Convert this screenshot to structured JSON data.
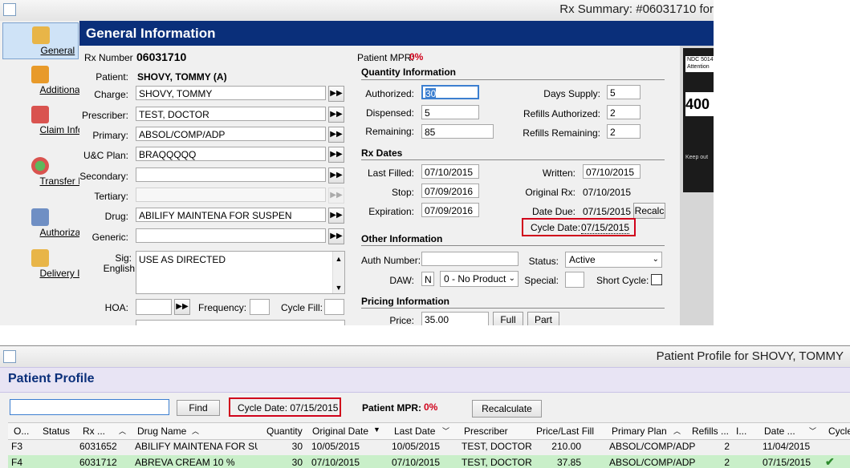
{
  "rx_window": {
    "title": "Rx Summary: #06031710 for",
    "header": "General Information",
    "nav": [
      {
        "label": "General",
        "icon": "document-icon"
      },
      {
        "label": "Additional",
        "icon": "pill-bottle-icon"
      },
      {
        "label": "Claim Information",
        "icon": "claim-icon"
      },
      {
        "label": "Transfer Information",
        "icon": "transfer-icon"
      },
      {
        "label": "Authorization",
        "icon": "pen-icon"
      },
      {
        "label": "Delivery Information",
        "icon": "delivery-icon"
      }
    ],
    "rx_number_label": "Rx Number",
    "rx_number": "06031710",
    "patient_mpr_label": "Patient MPR:",
    "patient_mpr": "0%",
    "patient_label": "Patient:",
    "patient": "SHOVY, TOMMY (A)",
    "charge_label": "Charge:",
    "charge": "SHOVY, TOMMY",
    "prescriber_label": "Prescriber:",
    "prescriber": "TEST, DOCTOR",
    "primary_label": "Primary:",
    "primary": "ABSOL/COMP/ADP",
    "uc_plan_label": "U&C Plan:",
    "uc_plan": "BRAQQQQQ",
    "secondary_label": "Secondary:",
    "secondary": "",
    "tertiary_label": "Tertiary:",
    "tertiary": "",
    "drug_label": "Drug:",
    "drug": "ABILIFY MAINTENA FOR SUSPEN",
    "generic_label": "Generic:",
    "generic": "",
    "sig_label": "Sig:",
    "english_label": "English",
    "sig": "USE AS DIRECTED",
    "hoa_label": "HOA:",
    "frequency_label": "Frequency:",
    "cycle_fill_label": "Cycle Fill:",
    "quantity_info": {
      "title": "Quantity Information",
      "authorized_label": "Authorized:",
      "authorized": "30",
      "dispensed_label": "Dispensed:",
      "dispensed": "5",
      "remaining_label": "Remaining:",
      "remaining": "85",
      "days_supply_label": "Days Supply:",
      "days_supply": "5",
      "refills_authorized_label": "Refills Authorized:",
      "refills_authorized": "2",
      "refills_remaining_label": "Refills Remaining:",
      "refills_remaining": "2"
    },
    "rx_dates": {
      "title": "Rx Dates",
      "last_filled_label": "Last Filled:",
      "last_filled": "07/10/2015",
      "stop_label": "Stop:",
      "stop": "07/09/2016",
      "expiration_label": "Expiration:",
      "expiration": "07/09/2016",
      "written_label": "Written:",
      "written": "07/10/2015",
      "original_rx_label": "Original Rx:",
      "original_rx": "07/10/2015",
      "date_due_label": "Date Due:",
      "date_due": "07/15/2015",
      "recalc_label": "Recalc",
      "cycle_date_label": "Cycle Date:",
      "cycle_date": "07/15/2015"
    },
    "other_info": {
      "title": "Other Information",
      "auth_number_label": "Auth Number:",
      "auth_number": "",
      "status_label": "Status:",
      "status": "Active",
      "daw_label": "DAW:",
      "daw_code": "N",
      "daw_value": "0 - No Product",
      "special_label": "Special:",
      "special": "",
      "short_cycle_label": "Short Cycle:"
    },
    "pricing_info": {
      "title": "Pricing Information",
      "price_label": "Price:",
      "price": "35.00",
      "full_label": "Full",
      "part_label": "Part"
    },
    "image_panel": {
      "ndc": "NDC 5014",
      "attention": "Attention",
      "number": "400",
      "keep_out": "Keep out"
    }
  },
  "profile_window": {
    "title": "Patient Profile for SHOVY, TOMMY",
    "header": "Patient Profile",
    "search_value": "",
    "find_label": "Find",
    "cycle_date_text": "Cycle Date: 07/15/2015",
    "patient_mpr_label": "Patient MPR:",
    "patient_mpr": "0%",
    "recalculate_label": "Recalculate",
    "columns": [
      "O...",
      "Status",
      "Rx ...",
      "Drug Name",
      "Quantity",
      "Original Date",
      "Last Date",
      "Prescriber",
      "Price/Last Fill",
      "Primary Plan",
      "Refills ...",
      "I...",
      "Date ...",
      "Cycle"
    ],
    "rows": [
      {
        "o": "F3",
        "status": "",
        "rx": "6031652",
        "drug": "ABILIFY MAINTENA FOR SUSPEN",
        "qty": "30",
        "orig": "10/05/2015",
        "last": "10/05/2015",
        "prescriber": "TEST, DOCTOR",
        "price": "210.00",
        "plan": "ABSOL/COMP/ADP",
        "refills": "2",
        "i": "",
        "date": "11/04/2015",
        "cycle": ""
      },
      {
        "o": "F4",
        "status": "",
        "rx": "6031712",
        "drug": "ABREVA CREAM 10 %",
        "qty": "30",
        "orig": "07/10/2015",
        "last": "07/10/2015",
        "prescriber": "TEST, DOCTOR",
        "price": "37.85",
        "plan": "ABSOL/COMP/ADP",
        "refills": "2",
        "i": "",
        "date": "07/15/2015",
        "cycle": "✔"
      }
    ]
  },
  "colors": {
    "header_blue": "#0a2f7a",
    "mpr_red": "#d0021b",
    "highlight_row": "#c9efc9",
    "cycle_check": "#2e8b2e"
  }
}
